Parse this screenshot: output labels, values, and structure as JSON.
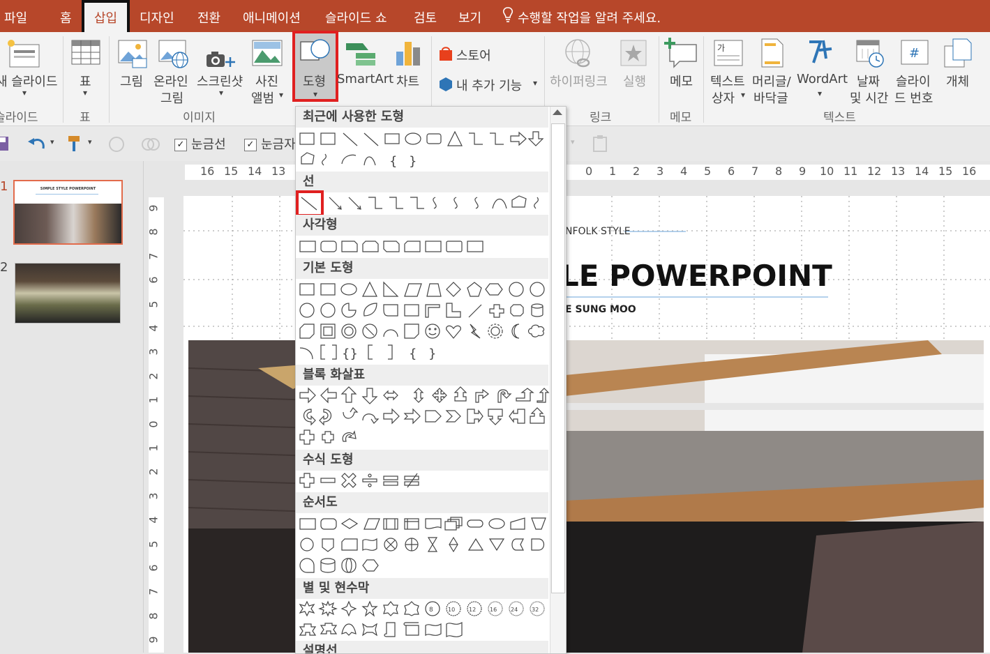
{
  "menubar": {
    "tabs": [
      "파일",
      "홈",
      "삽입",
      "디자인",
      "전환",
      "애니메이션",
      "슬라이드 쇼",
      "검토",
      "보기"
    ],
    "tell_me": "수행할 작업을 알려 주세요."
  },
  "ribbon": {
    "new_slide": "새 슬라이드",
    "table": "표",
    "picture": "그림",
    "online_picture_1": "온라인",
    "online_picture_2": "그림",
    "screenshot": "스크린샷",
    "photo_album_1": "사진",
    "photo_album_2": "앨범",
    "shapes": "도형",
    "smartart": "SmartArt",
    "chart": "차트",
    "store": "스토어",
    "my_addins": "내 추가 기능",
    "hyperlink": "하이퍼링크",
    "action": "실행",
    "comment": "메모",
    "textbox_1": "텍스트",
    "textbox_2": "상자",
    "header_footer_1": "머리글/",
    "header_footer_2": "바닥글",
    "wordart": "WordArt",
    "datetime_1": "날짜",
    "datetime_2": "및 시간",
    "slide_number_1": "슬라이",
    "slide_number_2": "드 번호",
    "object": "개체",
    "groups": {
      "slides": "슬라이드",
      "table": "표",
      "images": "이미지",
      "links": "링크",
      "comments": "메모",
      "text": "텍스트"
    }
  },
  "qat": {
    "gridlines": "눈금선",
    "guides": "눈금자"
  },
  "slides_pane": {
    "slide1_number": "1",
    "slide2_number": "2",
    "slide1_title": "SIMPLE STYLE POWERPOINT"
  },
  "rulers": {
    "h_left": [
      "16",
      "15",
      "14",
      "13"
    ],
    "h_right": [
      "0",
      "1",
      "2",
      "3",
      "4",
      "5",
      "6",
      "7",
      "8",
      "9",
      "10",
      "11",
      "12",
      "13",
      "14",
      "15",
      "16"
    ],
    "v_labels": [
      "9",
      "8",
      "7",
      "6",
      "5",
      "4",
      "3",
      "2",
      "1",
      "0",
      "1",
      "2",
      "3",
      "4",
      "5",
      "6",
      "7",
      "8",
      "9"
    ]
  },
  "slide": {
    "subtitle_small": "NFOLK STYLE",
    "title": "LE POWERPOINT",
    "author": "E SUNG MOO"
  },
  "shapes_dropdown": {
    "recent": "최근에 사용한 도형",
    "lines": "선",
    "rectangles": "사각형",
    "basic": "기본 도형",
    "block_arrows": "블록 화살표",
    "equation": "수식 도형",
    "flowchart": "순서도",
    "stars": "별 및 현수막",
    "callouts": "설명선"
  },
  "colors": {
    "accent": "#b7472a",
    "highlight": "#e02020"
  }
}
